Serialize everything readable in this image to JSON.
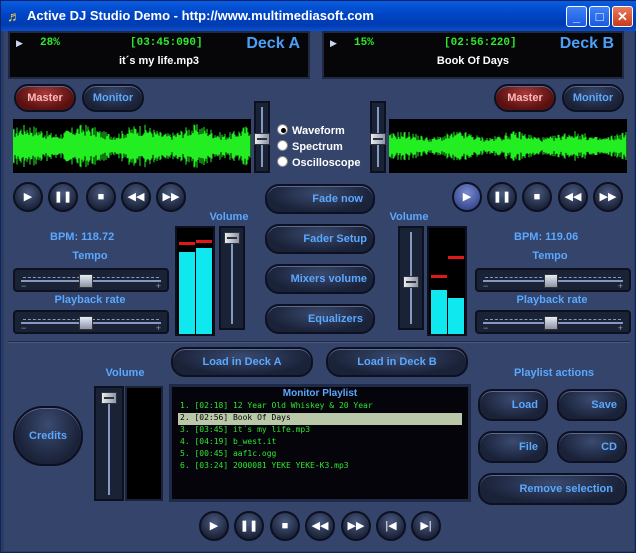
{
  "window": {
    "title": "Active DJ Studio Demo - http://www.multimediasoft.com",
    "icon": "app-icon"
  },
  "titlebar": {
    "minimize_glyph": "_",
    "maximize_glyph": "□",
    "close_glyph": "✕"
  },
  "deckA": {
    "play_glyph": "▶",
    "percent": "28%",
    "time": "[03:45:090]",
    "name": "Deck A",
    "song": "it´s my life.mp3",
    "master_label": "Master",
    "monitor_label": "Monitor",
    "bpm": "BPM: 118.72",
    "tempo_label": "Tempo",
    "rate_label": "Playback rate",
    "volume_label": "Volume",
    "tempo_pos": 0.5,
    "rate_pos": 0.5,
    "volume_pos": 0.95
  },
  "deckB": {
    "play_glyph": "▶",
    "percent": "15%",
    "time": "[02:56:220]",
    "name": "Deck B",
    "song": "Book Of Days",
    "master_label": "Master",
    "monitor_label": "Monitor",
    "bpm": "BPM: 119.06",
    "tempo_label": "Tempo",
    "rate_label": "Playback rate",
    "volume_label": "Volume",
    "tempo_pos": 0.5,
    "rate_pos": 0.5,
    "volume_pos": 0.55
  },
  "display_modes": [
    {
      "label": "Waveform",
      "selected": true
    },
    {
      "label": "Spectrum",
      "selected": false
    },
    {
      "label": "Oscilloscope",
      "selected": false
    }
  ],
  "transport_glyphs": {
    "play": "▶",
    "pause": "❚❚",
    "stop": "■",
    "rewind": "◀◀",
    "forward": "▶▶",
    "prev": "|◀",
    "next": "▶|"
  },
  "center_buttons": {
    "fade_now": "Fade now",
    "fader_setup": "Fader Setup",
    "mixers_volume": "Mixers volume",
    "equalizers": "Equalizers"
  },
  "bottom": {
    "credits": "Credits",
    "volume_label": "Volume",
    "load_a": "Load in Deck A",
    "load_b": "Load in Deck B",
    "playlist_title": "Monitor Playlist",
    "playlist_actions": "Playlist actions",
    "load": "Load",
    "save": "Save",
    "file": "File",
    "cd": "CD",
    "remove_selection": "Remove selection",
    "monitor_volume": 0.95,
    "playlist": [
      "1. [02:18] 12 Year Old Whiskey & 20 Year",
      "2. [02:56] Book Of Days",
      "3. [03:45] it´s my life.mp3",
      "4. [04:19] b_west.it",
      "5. [00:45] aaf1c.ogg",
      "6. [03:24] 2000081 YEKE YEKE-K3.mp3"
    ],
    "playlist_selected": 1
  },
  "colors": {
    "accent": "#5aa8ff",
    "wave": "#22ee22",
    "vu": "#10e8f0",
    "peak": "#e01818"
  }
}
